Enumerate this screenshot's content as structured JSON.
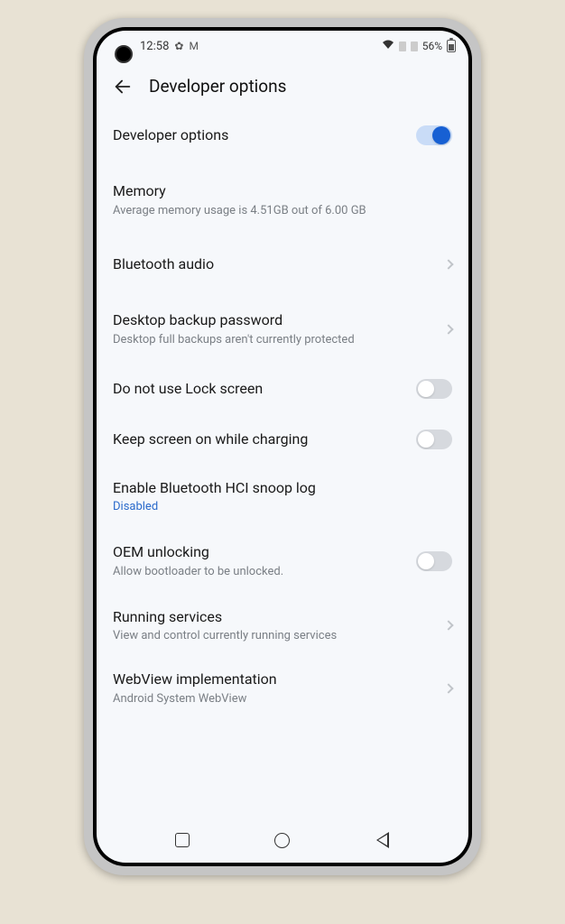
{
  "status": {
    "time": "12:58",
    "battery_pct": "56%"
  },
  "header": {
    "title": "Developer options"
  },
  "rows": {
    "dev_options": {
      "title": "Developer options",
      "toggle": true
    },
    "memory": {
      "title": "Memory",
      "sub": "Average memory usage is 4.51GB out of 6.00 GB"
    },
    "bt_audio": {
      "title": "Bluetooth audio"
    },
    "desktop_backup": {
      "title": "Desktop backup password",
      "sub": "Desktop full backups aren't currently protected"
    },
    "lock_screen": {
      "title": "Do not use Lock screen",
      "toggle": false
    },
    "keep_screen": {
      "title": "Keep screen on while charging",
      "toggle": false
    },
    "hci_snoop": {
      "title": "Enable Bluetooth HCI snoop log",
      "sub": "Disabled"
    },
    "oem": {
      "title": "OEM unlocking",
      "sub": "Allow bootloader to be unlocked.",
      "toggle": false
    },
    "running": {
      "title": "Running services",
      "sub": "View and control currently running services"
    },
    "webview": {
      "title": "WebView implementation",
      "sub": "Android System WebView"
    }
  }
}
